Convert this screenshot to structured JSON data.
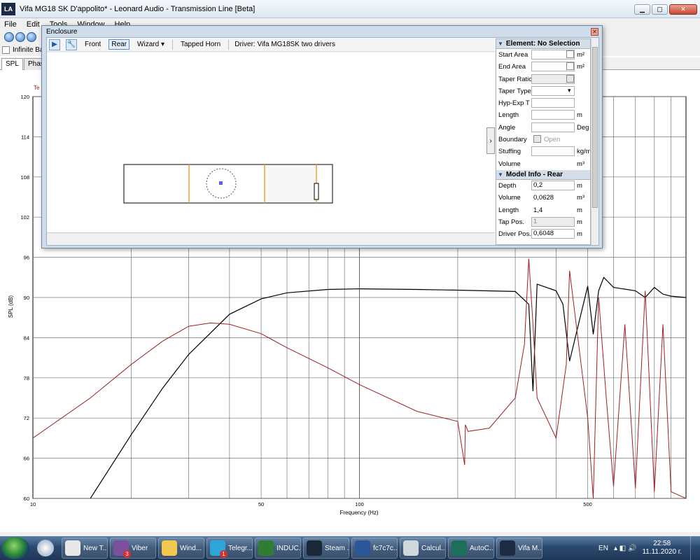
{
  "window": {
    "title": "Vifa MG18 SK D'appolito* - Leonard Audio - Transmission Line [Beta]",
    "logo": "LA"
  },
  "menu": [
    "File",
    "Edit",
    "Tools",
    "Window",
    "Help"
  ],
  "options": {
    "infinite_baffle": "Infinite Baff"
  },
  "tabs": [
    "SPL",
    "Phase"
  ],
  "plot": {
    "ylabel": "SPL (dB)",
    "xlabel": "Frequency (Hz)",
    "y_ticks": [
      "120",
      "114",
      "108",
      "102",
      "96",
      "90",
      "84",
      "78",
      "72",
      "66",
      "60"
    ],
    "x_ticks": [
      "10",
      "50",
      "100",
      "500"
    ],
    "legend_fragment": "Te"
  },
  "chart_data": {
    "type": "line",
    "xlabel": "Frequency (Hz)",
    "ylabel": "SPL (dB)",
    "xscale": "log",
    "xlim": [
      10,
      1000
    ],
    "ylim": [
      60,
      120
    ],
    "grid": true,
    "series": [
      {
        "color": "#000000",
        "x": [
          15,
          20,
          25,
          30,
          40,
          50,
          60,
          80,
          100,
          150,
          200,
          300,
          330,
          340,
          350,
          400,
          420,
          440,
          500,
          520,
          540,
          560,
          600,
          700,
          750,
          800,
          850,
          900,
          1000
        ],
        "y": [
          60,
          69.5,
          76.5,
          81.5,
          87.5,
          89.8,
          90.7,
          91.2,
          91.3,
          91.2,
          91.1,
          90.9,
          89,
          76,
          92,
          91,
          89,
          80.5,
          91.7,
          84.5,
          91,
          93,
          91.5,
          91,
          90,
          91.5,
          90.5,
          90.2,
          90
        ]
      },
      {
        "color": "#a02020",
        "x": [
          10,
          15,
          20,
          25,
          30,
          35,
          40,
          50,
          60,
          80,
          100,
          150,
          200,
          210,
          211,
          215,
          250,
          300,
          320,
          330,
          340,
          350,
          400,
          430,
          440,
          500,
          520,
          540,
          570,
          600,
          650,
          700,
          750,
          800,
          850,
          900,
          1000
        ],
        "y": [
          69,
          75,
          80,
          83.5,
          85.7,
          86.2,
          86,
          84.6,
          82.5,
          79.5,
          77,
          73,
          71.5,
          65,
          71,
          70,
          70.5,
          75,
          83,
          95.8,
          86,
          75,
          69,
          80,
          94,
          72,
          60,
          90,
          75,
          61.8,
          86,
          61.5,
          91,
          61,
          86,
          61,
          60
        ]
      }
    ]
  },
  "dialog": {
    "title": "Enclosure",
    "toolbar": {
      "front": "Front",
      "rear": "Rear",
      "wizard": "Wizard",
      "tapped_horn": "Tapped Horn",
      "driver": "Driver: Vifa MG18SK two drivers"
    },
    "element_section": "Element: No Selection",
    "element_rows": [
      {
        "label": "Start Area",
        "value": "",
        "unit": "m²",
        "checkbox": true
      },
      {
        "label": "End Area",
        "value": "",
        "unit": "m²",
        "checkbox": true
      },
      {
        "label": "Taper Ratio",
        "value": "",
        "unit": "",
        "checkbox": true,
        "disabled": true
      },
      {
        "label": "Taper Type",
        "value": "",
        "unit": "",
        "dropdown": true
      },
      {
        "label": "Hyp-Exp T",
        "value": "",
        "unit": ""
      },
      {
        "label": "Length",
        "value": "",
        "unit": "m"
      },
      {
        "label": "Angle",
        "value": "",
        "unit": "Deg"
      },
      {
        "label": "Boundary",
        "value": "",
        "unit": "",
        "checkbox_label": "Open"
      },
      {
        "label": "Stuffing",
        "value": "",
        "unit": "kg/m³"
      },
      {
        "label": "Volume",
        "value": "",
        "unit": "m³",
        "no_input": true
      }
    ],
    "model_section": "Model Info - Rear",
    "model_rows": [
      {
        "label": "Depth",
        "value": "0,2",
        "unit": "m"
      },
      {
        "label": "Volume",
        "value": "0,0628",
        "unit": "m³",
        "no_input": true
      },
      {
        "label": "Length",
        "value": "1,4",
        "unit": "m",
        "no_input": true
      },
      {
        "label": "Tap Pos.",
        "value": "1",
        "unit": "m",
        "disabled": true
      },
      {
        "label": "Driver Pos.",
        "value": "0,6048",
        "unit": "m"
      }
    ]
  },
  "taskbar": {
    "tasks": [
      {
        "label": "New T...",
        "color": "#e8e8e8"
      },
      {
        "label": "Viber",
        "color": "#7b519d"
      },
      {
        "label": "Wind...",
        "color": "#f2c94c"
      },
      {
        "label": "Telegr...",
        "color": "#2ea6da"
      },
      {
        "label": "INDUC...",
        "color": "#2e7d32"
      },
      {
        "label": "Steam ...",
        "color": "#1b2838"
      },
      {
        "label": "fc7c7c...",
        "color": "#2b579a"
      },
      {
        "label": "Calcul...",
        "color": "#cfd8dc"
      },
      {
        "label": "AutoC...",
        "color": "#1e6e5e"
      },
      {
        "label": "Vifa M...",
        "color": "#1d2a44"
      }
    ],
    "viber_badge": "3",
    "telegram_badge": "1",
    "lang": "EN",
    "time": "22:58",
    "date": "11.11.2020 г."
  }
}
